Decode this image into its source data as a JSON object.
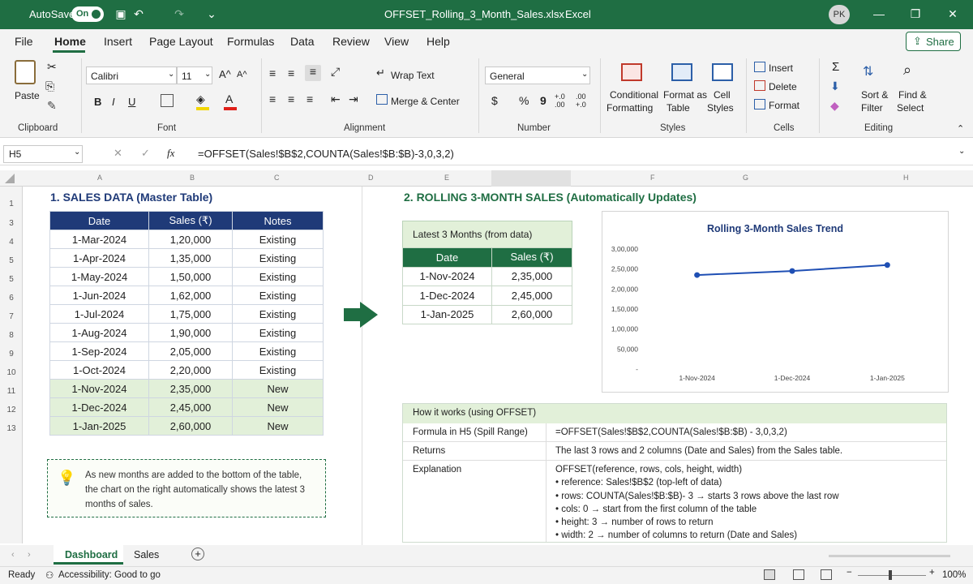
{
  "titlebar": {
    "autosave_label": "AutoSave",
    "autosave_state": "On",
    "file_name": "OFFSET_Rolling_3_Month_Sales.xlsx",
    "separator": "-",
    "app_name": "Excel",
    "user_initials": "PK"
  },
  "menu": {
    "items": [
      "File",
      "Home",
      "Insert",
      "Page Layout",
      "Formulas",
      "Data",
      "Review",
      "View",
      "Help"
    ],
    "share_label": "Share",
    "active": "Home"
  },
  "ribbon": {
    "clipboard": {
      "paste": "Paste",
      "group": "Clipboard"
    },
    "font": {
      "family": "Calibri",
      "size": "11",
      "bold": "B",
      "italic": "I",
      "underline": "U",
      "grow": "A^",
      "shrink": "A^",
      "group": "Font"
    },
    "alignment": {
      "wrap": "Wrap Text",
      "merge": "Merge & Center",
      "group": "Alignment"
    },
    "number": {
      "format": "General",
      "currency": "$",
      "percent": "%",
      "comma": "9",
      "inc": "+.0 .00",
      "dec": ".00 +.0",
      "group": "Number"
    },
    "styles": {
      "conditional": "Conditional",
      "conditional2": "Formatting",
      "format_table": "Format as",
      "format_table2": "Table",
      "cell_styles": "Cell",
      "cell_styles2": "Styles",
      "group": "Styles"
    },
    "cells": {
      "insert": "Insert",
      "delete": "Delete",
      "format": "Format",
      "group": "Cells"
    },
    "editing": {
      "sort": "Sort &",
      "sort2": "Filter",
      "find": "Find &",
      "find2": "Select",
      "group": "Editing"
    }
  },
  "formula_bar": {
    "name_box": "H5",
    "fx": "fx",
    "formula": "=OFFSET(Sales!$B$2,COUNTA(Sales!$B:$B)-3,0,3,2)"
  },
  "columns": [
    "A",
    "B",
    "C",
    "D",
    "E",
    "F",
    "G",
    "H"
  ],
  "rows": [
    "1",
    "3",
    "4",
    "5",
    "5",
    "6",
    "7",
    "8",
    "9",
    "10",
    "11",
    "12",
    "13"
  ],
  "left": {
    "heading": "1. SALES DATA (Master Table)",
    "headers": [
      "Date",
      "Sales (₹)",
      "Notes"
    ],
    "rows": [
      [
        "1-Mar-2024",
        "1,20,000",
        "Existing"
      ],
      [
        "1-Apr-2024",
        "1,35,000",
        "Existing"
      ],
      [
        "1-May-2024",
        "1,50,000",
        "Existing"
      ],
      [
        "1-Jun-2024",
        "1,62,000",
        "Existing"
      ],
      [
        "1-Jul-2024",
        "1,75,000",
        "Existing"
      ],
      [
        "1-Aug-2024",
        "1,90,000",
        "Existing"
      ],
      [
        "1-Sep-2024",
        "2,05,000",
        "Existing"
      ],
      [
        "1-Oct-2024",
        "2,20,000",
        "Existing"
      ],
      [
        "1-Nov-2024",
        "2,35,000",
        "New"
      ],
      [
        "1-Dec-2024",
        "2,45,000",
        "New"
      ],
      [
        "1-Jan-2025",
        "2,60,000",
        "New"
      ]
    ],
    "tip": "As new months are added to the bottom of the table, the chart on the right automatically shows the latest 3 months of sales."
  },
  "right": {
    "heading": "2. ROLLING 3-MONTH SALES (Automatically Updates)",
    "latest_title": "Latest 3 Months (from data)",
    "latest_headers": [
      "Date",
      "Sales (₹)"
    ],
    "latest_rows": [
      [
        "1-Nov-2024",
        "2,35,000"
      ],
      [
        "1-Dec-2024",
        "2,45,000"
      ],
      [
        "1-Jan-2025",
        "2,60,000"
      ]
    ],
    "how_title": "How it works (using OFFSET)",
    "how_rows": [
      {
        "label": "Formula in H5 (Spill Range)",
        "value": "=OFFSET(Sales!$B$2,COUNTA(Sales!$B:$B) - 3,0,3,2)"
      },
      {
        "label": "Returns",
        "value": "The last 3 rows and 2 columns (Date and Sales) from the Sales table."
      }
    ],
    "explanation_label": "Explanation",
    "explanation_lines": [
      "OFFSET(reference, rows, cols, height, width)",
      "• reference: Sales!$B$2 (top-left of data)",
      "• rows: COUNTA(Sales!$B:$B)- 3 → starts 3 rows above the last row",
      "• cols: 0 → start from the first column of the table",
      "• height: 3 → number of rows to return",
      "• width: 2 → number of columns to return (Date and Sales)"
    ]
  },
  "chart_data": {
    "type": "line",
    "title": "Rolling 3-Month Sales Trend",
    "categories": [
      "1-Nov-2024",
      "1-Dec-2024",
      "1-Jan-2025"
    ],
    "values": [
      235000,
      245000,
      260000
    ],
    "y_ticks": [
      "3,00,000",
      "2,50,000",
      "2,00,000",
      "1,50,000",
      "1,00,000",
      "50,000",
      "-"
    ],
    "ylim": [
      0,
      300000
    ],
    "grid": false,
    "color": "#1f4fb4"
  },
  "sheets": {
    "tabs": [
      "Dashboard",
      "Sales"
    ],
    "active": "Dashboard"
  },
  "status": {
    "ready": "Ready",
    "accessibility": "Accessibility: Good to go",
    "zoom": "100%"
  }
}
